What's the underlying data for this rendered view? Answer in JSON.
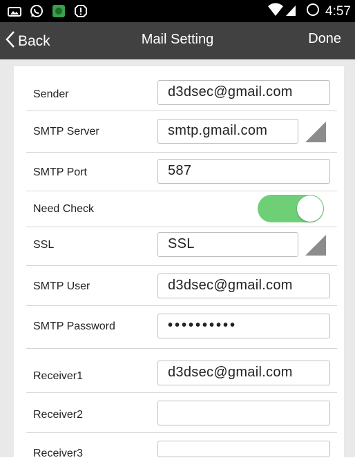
{
  "status_bar": {
    "time": "4:57",
    "icons": [
      "gallery-icon",
      "whatsapp-icon",
      "app-icon",
      "alert-icon",
      "wifi-icon",
      "signal-icon",
      "battery-icon"
    ]
  },
  "nav": {
    "back_label": "Back",
    "title": "Mail Setting",
    "done_label": "Done"
  },
  "form": {
    "sender": {
      "label": "Sender",
      "value": "d3dsec@gmail.com"
    },
    "smtp_server": {
      "label": "SMTP Server",
      "value": "smtp.gmail.com"
    },
    "smtp_port": {
      "label": "SMTP Port",
      "value": "587"
    },
    "need_check": {
      "label": "Need Check",
      "enabled": true
    },
    "ssl": {
      "label": "SSL",
      "value": "SSL"
    },
    "smtp_user": {
      "label": "SMTP User",
      "value": "d3dsec@gmail.com"
    },
    "smtp_password": {
      "label": "SMTP Password",
      "value": "••••••••••"
    },
    "receiver1": {
      "label": "Receiver1",
      "value": "d3dsec@gmail.com"
    },
    "receiver2": {
      "label": "Receiver2",
      "value": ""
    },
    "receiver3": {
      "label": "Receiver3",
      "value": ""
    }
  },
  "colors": {
    "nav_bg": "#414141",
    "toggle_on": "#6ecf77",
    "page_bg": "#e9e9e9"
  }
}
